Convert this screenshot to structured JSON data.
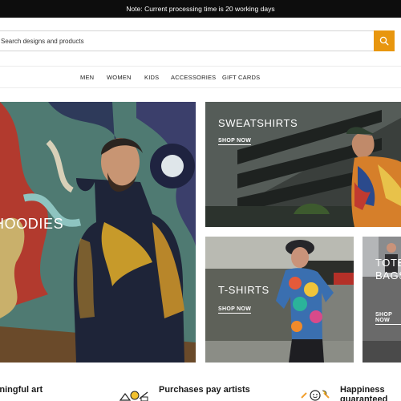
{
  "announcement": "Note: Current processing time is 20 working days",
  "search": {
    "placeholder": "Search designs and products",
    "button_icon": "search-icon"
  },
  "nav": {
    "items": [
      "MEN",
      "WOMEN",
      "KIDS",
      "ACCESSORIES",
      "GIFT CARDS"
    ]
  },
  "tiles": {
    "hoodies": {
      "title": "HOODIES"
    },
    "sweatshirts": {
      "title": "SWEATSHIRTS",
      "cta": "SHOP NOW"
    },
    "tshirts": {
      "title": "T-SHIRTS",
      "cta": "SHOP NOW"
    },
    "totebags": {
      "title": "TOTE BAGS",
      "cta": "SHOP NOW"
    }
  },
  "features": [
    "Meaningful art",
    "Purchases pay artists",
    "Happiness guaranteed"
  ],
  "colors": {
    "accent": "#e8960e",
    "topbar": "#0d0d0d"
  }
}
